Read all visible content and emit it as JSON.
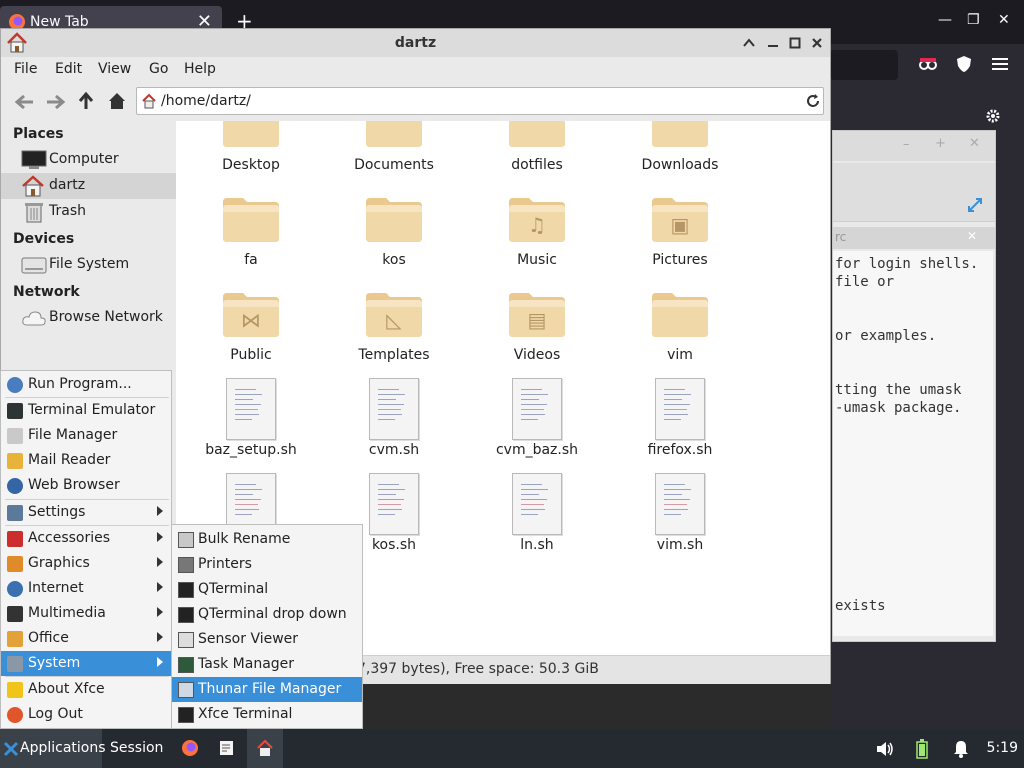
{
  "browser": {
    "tab_title": "New Tab",
    "tab_close": "✕",
    "new_tab": "+",
    "win_min": "—",
    "win_max": "❐",
    "win_close": "✕"
  },
  "background_window": {
    "tab_label": "rc",
    "lines": [
      "for login shells.",
      "file or",
      "or examples.",
      "tting the umask",
      "-umask package.",
      "exists"
    ]
  },
  "thunar": {
    "title": "dartz",
    "menu": [
      "File",
      "Edit",
      "View",
      "Go",
      "Help"
    ],
    "path": "/home/dartz/",
    "sidebar": {
      "places_header": "Places",
      "places": [
        "Computer",
        "dartz",
        "Trash"
      ],
      "devices_header": "Devices",
      "devices": [
        "File System"
      ],
      "network_header": "Network",
      "network": [
        "Browse Network"
      ]
    },
    "files": [
      {
        "name": "Desktop",
        "type": "folder",
        "glyph": ""
      },
      {
        "name": "Documents",
        "type": "folder",
        "glyph": ""
      },
      {
        "name": "dotfiles",
        "type": "folder",
        "glyph": ""
      },
      {
        "name": "Downloads",
        "type": "folder",
        "glyph": ""
      },
      {
        "name": "fa",
        "type": "folder",
        "glyph": ""
      },
      {
        "name": "kos",
        "type": "folder",
        "glyph": ""
      },
      {
        "name": "Music",
        "type": "folder",
        "glyph": "♫"
      },
      {
        "name": "Pictures",
        "type": "folder",
        "glyph": "▣"
      },
      {
        "name": "Public",
        "type": "folder",
        "glyph": "⋈"
      },
      {
        "name": "Templates",
        "type": "folder",
        "glyph": "◺"
      },
      {
        "name": "Videos",
        "type": "folder",
        "glyph": "▤"
      },
      {
        "name": "vim",
        "type": "folder",
        "glyph": ""
      },
      {
        "name": "baz_setup.sh",
        "type": "doc",
        "glyph": ""
      },
      {
        "name": "cvm.sh",
        "type": "doc",
        "glyph": ""
      },
      {
        "name": "cvm_baz.sh",
        "type": "doc",
        "glyph": ""
      },
      {
        "name": "firefox.sh",
        "type": "doc",
        "glyph": ""
      },
      {
        "name": "",
        "type": "doc",
        "glyph": ""
      },
      {
        "name": "kos.sh",
        "type": "doc",
        "glyph": ""
      },
      {
        "name": "ln.sh",
        "type": "doc",
        "glyph": ""
      },
      {
        "name": "vim.sh",
        "type": "doc",
        "glyph": ""
      }
    ],
    "status": "7,397 bytes), Free space: 50.3 GiB"
  },
  "app_menu": {
    "items": [
      {
        "label": "Run Program...",
        "icon": "run-icon",
        "color": "#4a7cc0",
        "submenu": false
      },
      {
        "label": "Terminal Emulator",
        "icon": "terminal-icon",
        "color": "#2e3436",
        "submenu": false
      },
      {
        "label": "File Manager",
        "icon": "folder-icon",
        "color": "#c9c9c9",
        "submenu": false
      },
      {
        "label": "Mail Reader",
        "icon": "mail-icon",
        "color": "#e8b33a",
        "submenu": false
      },
      {
        "label": "Web Browser",
        "icon": "globe-icon",
        "color": "#3465a4",
        "submenu": false
      },
      {
        "label": "Settings",
        "icon": "settings-icon",
        "color": "#5b7a99",
        "submenu": true
      },
      {
        "label": "Accessories",
        "icon": "accessories-icon",
        "color": "#cc2e2e",
        "submenu": true
      },
      {
        "label": "Graphics",
        "icon": "graphics-icon",
        "color": "#e08b2a",
        "submenu": true
      },
      {
        "label": "Internet",
        "icon": "internet-icon",
        "color": "#3a6fb0",
        "submenu": true
      },
      {
        "label": "Multimedia",
        "icon": "multimedia-icon",
        "color": "#333333",
        "submenu": true
      },
      {
        "label": "Office",
        "icon": "office-icon",
        "color": "#e3a13a",
        "submenu": true
      },
      {
        "label": "System",
        "icon": "system-icon",
        "color": "#8a97a6",
        "submenu": true
      },
      {
        "label": "About Xfce",
        "icon": "star-icon",
        "color": "#f0c419",
        "submenu": false
      },
      {
        "label": "Log Out",
        "icon": "logout-icon",
        "color": "#e0562a",
        "submenu": false
      }
    ],
    "highlight": "System"
  },
  "system_submenu": {
    "items": [
      {
        "label": "Bulk Rename",
        "icon": "bulk-rename-icon"
      },
      {
        "label": "Printers",
        "icon": "printer-icon"
      },
      {
        "label": "QTerminal",
        "icon": "qterminal-icon"
      },
      {
        "label": "QTerminal drop down",
        "icon": "qterminal-dropdown-icon"
      },
      {
        "label": "Sensor Viewer",
        "icon": "sensor-icon"
      },
      {
        "label": "Task Manager",
        "icon": "task-manager-icon"
      },
      {
        "label": "Thunar File Manager",
        "icon": "thunar-icon"
      },
      {
        "label": "Xfce Terminal",
        "icon": "xfce-terminal-icon"
      }
    ],
    "highlight": "Thunar File Manager"
  },
  "taskbar": {
    "applications": "Applications",
    "session": "Session",
    "clock": "5:19"
  },
  "colors": {
    "accent": "#3a8fd9",
    "folder": "#f1d8a8",
    "taskbar": "#252a30"
  }
}
